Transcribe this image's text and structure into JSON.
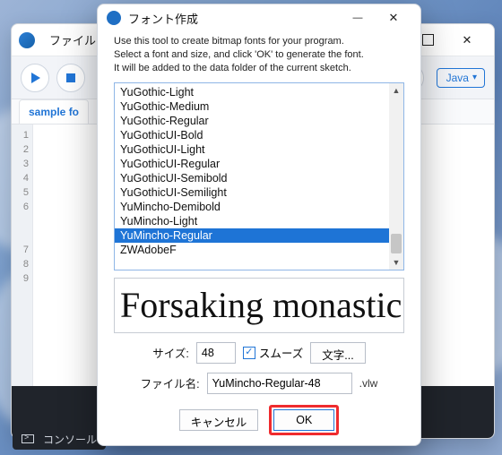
{
  "editor": {
    "menu_file": "ファイル",
    "tab_label": "sample fo",
    "mode": "Java",
    "gutter": [
      "1",
      "2",
      "3",
      "4",
      "5",
      "6",
      "",
      "",
      "7",
      "8",
      "9"
    ],
    "console_label": "コンソール"
  },
  "dialog": {
    "title": "フォント作成",
    "instructions_l1": "Use this tool to create bitmap fonts for your program.",
    "instructions_l2": "Select a font and size, and click 'OK' to generate the font.",
    "instructions_l3": "It will be added to the data folder of the current sketch.",
    "fonts": [
      "YuGothic-Light",
      "YuGothic-Medium",
      "YuGothic-Regular",
      "YuGothicUI-Bold",
      "YuGothicUI-Light",
      "YuGothicUI-Regular",
      "YuGothicUI-Semibold",
      "YuGothicUI-Semilight",
      "YuMincho-Demibold",
      "YuMincho-Light",
      "YuMincho-Regular",
      "ZWAdobeF"
    ],
    "selected_index": 10,
    "preview_text": "Forsaking monastic",
    "size_label": "サイズ:",
    "size_value": "48",
    "smooth_label": "スムーズ",
    "smooth_checked": true,
    "chars_button": "文字...",
    "filename_label": "ファイル名:",
    "filename_value": "YuMincho-Regular-48",
    "filename_ext": ".vlw",
    "cancel_label": "キャンセル",
    "ok_label": "OK"
  }
}
